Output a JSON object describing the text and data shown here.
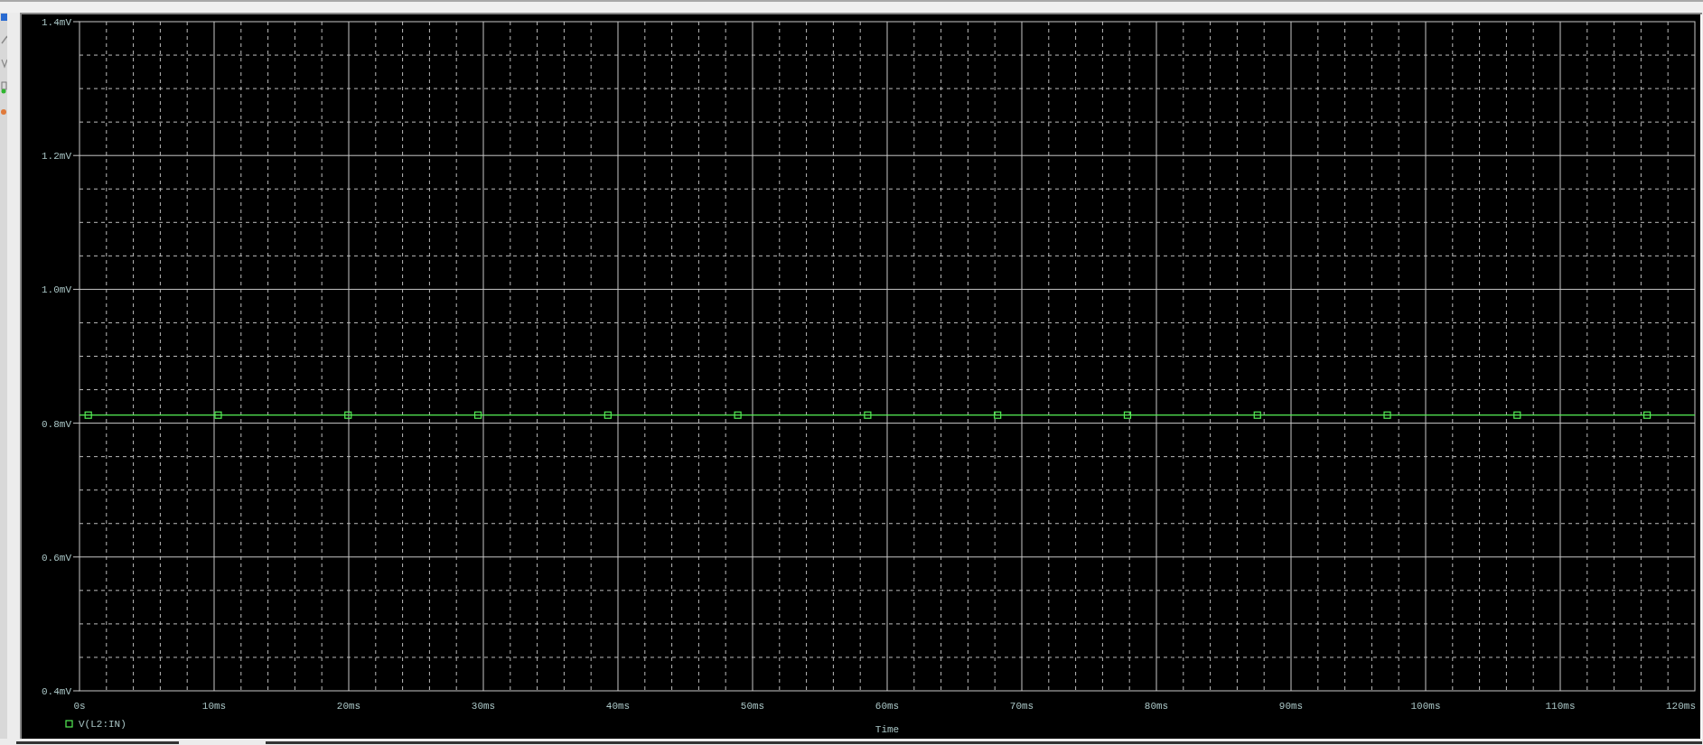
{
  "chart_data": {
    "type": "line",
    "grid": true,
    "xlabel": "Time",
    "xlim": [
      0,
      120
    ],
    "ylim": [
      0.4,
      1.4
    ],
    "xticks": [
      {
        "value": 0,
        "label": "0s"
      },
      {
        "value": 10,
        "label": "10ms"
      },
      {
        "value": 20,
        "label": "20ms"
      },
      {
        "value": 30,
        "label": "30ms"
      },
      {
        "value": 40,
        "label": "40ms"
      },
      {
        "value": 50,
        "label": "50ms"
      },
      {
        "value": 60,
        "label": "60ms"
      },
      {
        "value": 70,
        "label": "70ms"
      },
      {
        "value": 80,
        "label": "80ms"
      },
      {
        "value": 90,
        "label": "90ms"
      },
      {
        "value": 100,
        "label": "100ms"
      },
      {
        "value": 110,
        "label": "110ms"
      },
      {
        "value": 120,
        "label": "120ms"
      }
    ],
    "yticks": [
      {
        "value": 0.4,
        "label": "0.4mV"
      },
      {
        "value": 0.6,
        "label": "0.6mV"
      },
      {
        "value": 0.8,
        "label": "0.8mV"
      },
      {
        "value": 1.0,
        "label": "1.0mV"
      },
      {
        "value": 1.2,
        "label": "1.2mV"
      },
      {
        "value": 1.4,
        "label": "1.4mV"
      }
    ],
    "x": [
      0,
      0.65,
      10.3,
      19.95,
      29.6,
      39.25,
      48.9,
      58.55,
      68.2,
      77.85,
      87.5,
      97.15,
      106.8,
      116.45,
      120
    ],
    "series": [
      {
        "name": "V(L2:IN)",
        "color": "#55ee55",
        "marker": "square",
        "values": [
          0.812,
          0.812,
          0.812,
          0.812,
          0.812,
          0.812,
          0.812,
          0.812,
          0.812,
          0.812,
          0.812,
          0.812,
          0.812,
          0.812,
          0.812
        ]
      }
    ]
  }
}
